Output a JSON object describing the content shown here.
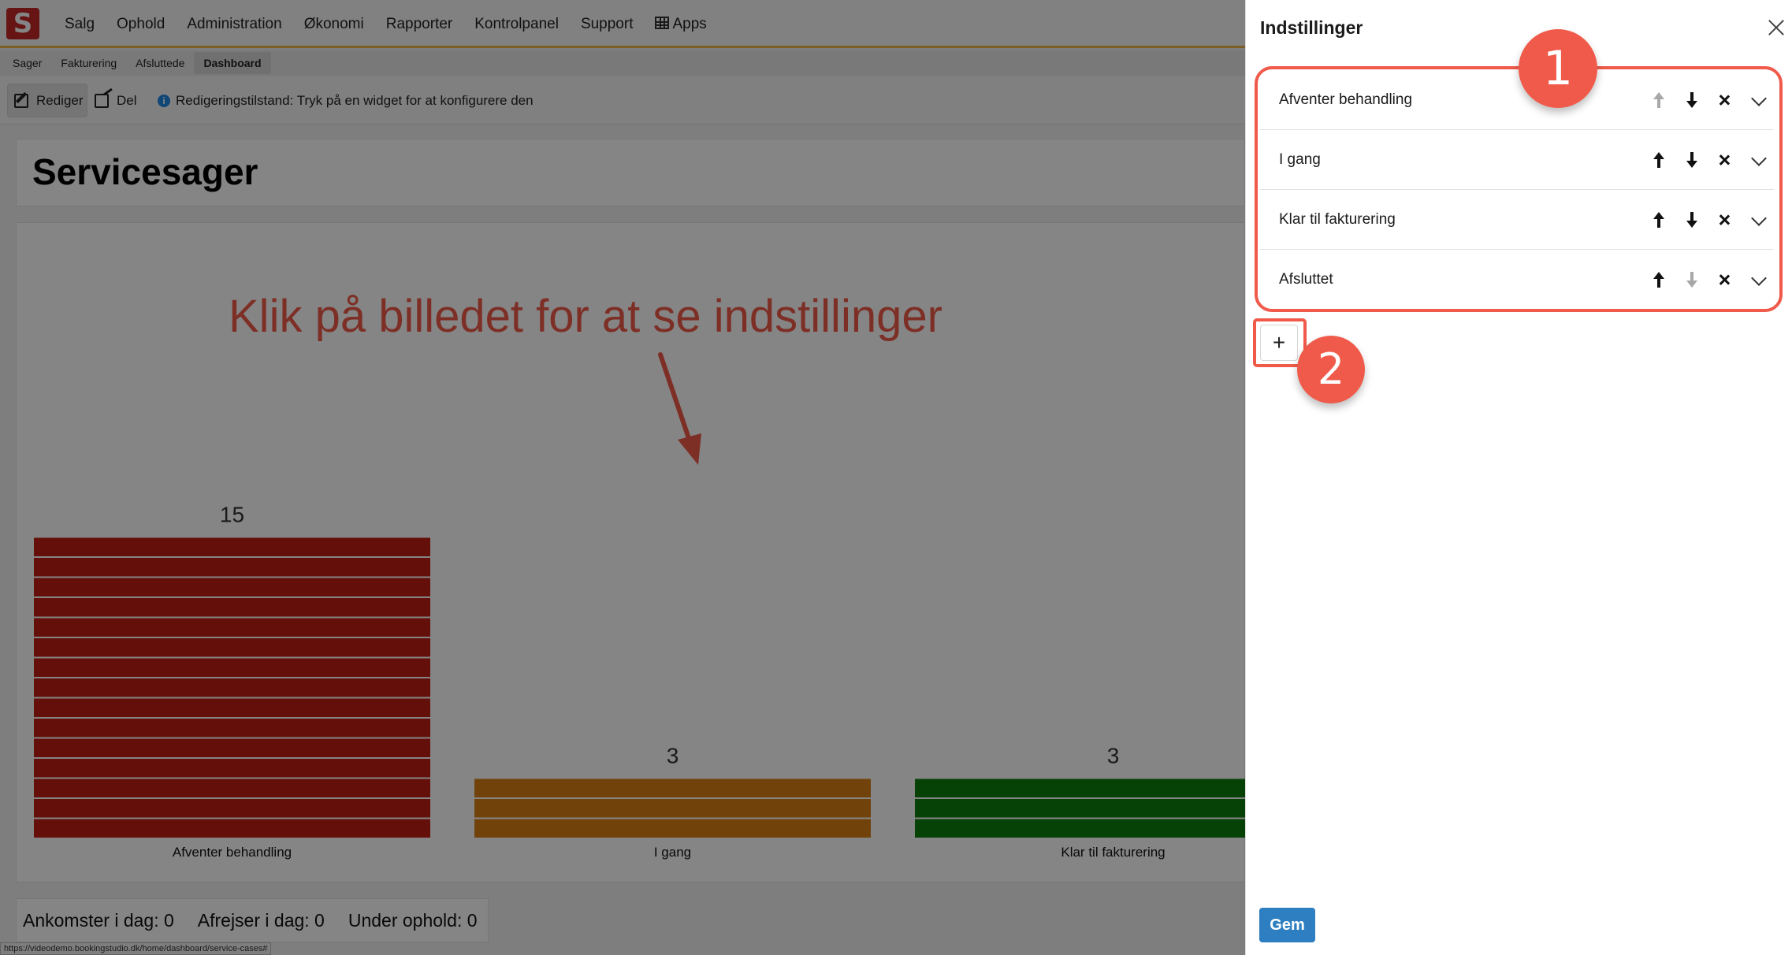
{
  "nav": {
    "items": [
      "Salg",
      "Ophold",
      "Administration",
      "Økonomi",
      "Rapporter",
      "Kontrolpanel",
      "Support"
    ],
    "apps_label": "Apps"
  },
  "subnav": {
    "items": [
      "Sager",
      "Fakturering",
      "Afsluttede",
      "Dashboard"
    ],
    "active": "Dashboard"
  },
  "toolbar": {
    "edit_label": "Rediger",
    "share_label": "Del",
    "info_text": "Redigeringstilstand: Tryk på en widget for at konfigurere den"
  },
  "page": {
    "title": "Servicesager"
  },
  "annotation": {
    "text": "Klik på billedet for at se indstillinger"
  },
  "chart_data": {
    "type": "bar",
    "categories": [
      "Afventer behandling",
      "I gang",
      "Klar til fakturering"
    ],
    "values": [
      15,
      3,
      3
    ],
    "colors": [
      "#c01d12",
      "#d97f14",
      "#0d7d0d"
    ],
    "title": "",
    "xlabel": "",
    "ylabel": ""
  },
  "footer": {
    "arrivals": "Ankomster i dag: 0",
    "departures": "Afrejser i dag: 0",
    "staying": "Under ophold: 0"
  },
  "status_url": "https://videodemo.bookingstudio.dk/home/dashboard/service-cases#",
  "panel": {
    "title": "Indstillinger",
    "rows": [
      {
        "label": "Afventer behandling",
        "up_enabled": false,
        "down_enabled": true
      },
      {
        "label": "I gang",
        "up_enabled": true,
        "down_enabled": true
      },
      {
        "label": "Klar til fakturering",
        "up_enabled": true,
        "down_enabled": true
      },
      {
        "label": "Afsluttet",
        "up_enabled": true,
        "down_enabled": false
      }
    ],
    "add_label": "+",
    "save_label": "Gem",
    "badge_1": "1",
    "badge_2": "2"
  },
  "colors": {
    "accent": "#f05a4a",
    "primary": "#2d7fc1",
    "nav_border": "#f0b74a"
  }
}
